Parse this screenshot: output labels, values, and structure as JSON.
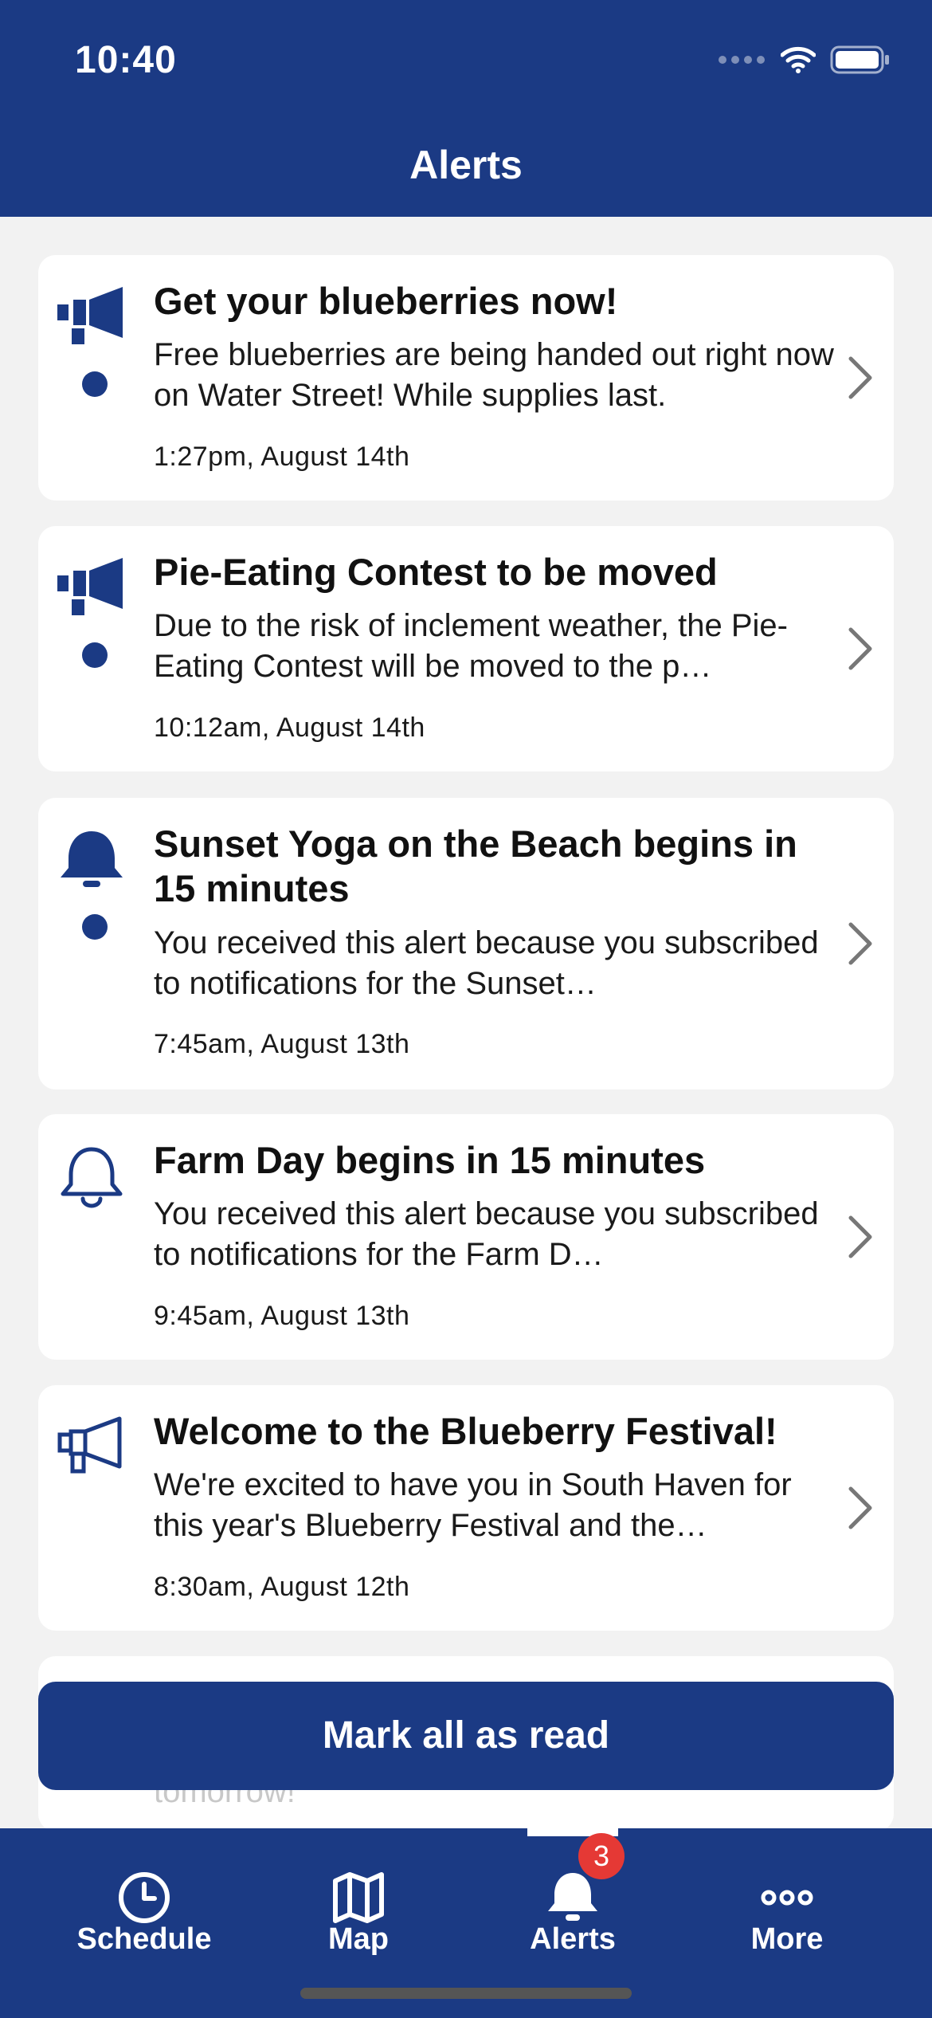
{
  "status_bar": {
    "time": "10:40"
  },
  "header": {
    "title": "Alerts"
  },
  "alerts": [
    {
      "icon": "megaphone-filled-icon",
      "unread": true,
      "title": "Get your blueberries now!",
      "body": "Free blueberries are being handed out right now on Water Street! While supplies last.",
      "time": "1:27pm, August 14th"
    },
    {
      "icon": "megaphone-filled-icon",
      "unread": true,
      "title": "Pie-Eating Contest to be moved",
      "body": "Due to the risk of inclement weather, the Pie-Eating Contest will be moved to the p…",
      "time": "10:12am, August 14th"
    },
    {
      "icon": "bell-filled-icon",
      "unread": true,
      "title": "Sunset Yoga on the Beach begins in 15 minutes",
      "body": "You received this alert because you subscribed to notifications for the Sunset…",
      "time": "7:45am, August 13th"
    },
    {
      "icon": "bell-outline-icon",
      "unread": false,
      "title": "Farm Day begins in 15 minutes",
      "body": "You received this alert because you subscribed to notifications for the Farm D…",
      "time": "9:45am, August 13th"
    },
    {
      "icon": "megaphone-outline-icon",
      "unread": false,
      "title": "Welcome to the Blueberry Festival!",
      "body": "We're excited to have you in South Haven for this year's Blueberry Festival and the…",
      "time": "8:30am, August 12th"
    }
  ],
  "peek_text": "tomorrow!",
  "mark_all_button": "Mark all as read",
  "tabbar": {
    "tabs": [
      {
        "label": "Schedule",
        "icon": "clock-icon"
      },
      {
        "label": "Map",
        "icon": "map-icon"
      },
      {
        "label": "Alerts",
        "icon": "bell-icon",
        "selected": true,
        "badge": "3"
      },
      {
        "label": "More",
        "icon": "more-dots-icon"
      }
    ]
  },
  "colors": {
    "brand": "#1b3a84",
    "badge": "#e53935",
    "background": "#f2f2f2"
  }
}
